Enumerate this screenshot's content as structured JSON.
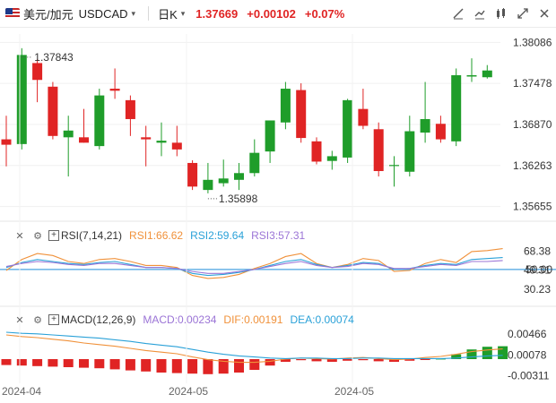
{
  "header": {
    "pair_label": "美元/加元",
    "symbol": "USDCAD",
    "caret": "▾",
    "timeframe": "日K",
    "timeframe_caret": "▾",
    "last_price": "1.37669",
    "change": "+0.00102",
    "change_pct": "+0.07%",
    "tools": [
      "draw-icon",
      "line-icon",
      "compare-icon",
      "expand-icon",
      "close-icon"
    ]
  },
  "colors": {
    "up": "#1f9d2a",
    "down": "#e02424",
    "rsi1": "#f0913a",
    "rsi2": "#2aa1d8",
    "rsi3": "#9b74d6"
  },
  "chart_data": [
    {
      "type": "candlestick",
      "title": "USDCAD 日K",
      "y_axis_ticks": [
        "1.38086",
        "1.37478",
        "1.36870",
        "1.36263",
        "1.35655"
      ],
      "y_axis_values": [
        1.38086,
        1.37478,
        1.3687,
        1.36263,
        1.35655
      ],
      "ylim": [
        1.3553,
        1.3821
      ],
      "annotations": {
        "high": "1.37843",
        "low": "1.35898"
      },
      "candles": [
        {
          "o": 1.3665,
          "h": 1.37,
          "l": 1.3625,
          "c": 1.3657
        },
        {
          "o": 1.3658,
          "h": 1.38,
          "l": 1.365,
          "c": 1.379
        },
        {
          "o": 1.3778,
          "h": 1.3784,
          "l": 1.372,
          "c": 1.3753
        },
        {
          "o": 1.3743,
          "h": 1.375,
          "l": 1.3665,
          "c": 1.367
        },
        {
          "o": 1.3668,
          "h": 1.37,
          "l": 1.361,
          "c": 1.3678
        },
        {
          "o": 1.3668,
          "h": 1.371,
          "l": 1.366,
          "c": 1.366
        },
        {
          "o": 1.3655,
          "h": 1.374,
          "l": 1.365,
          "c": 1.373
        },
        {
          "o": 1.374,
          "h": 1.377,
          "l": 1.3725,
          "c": 1.3737
        },
        {
          "o": 1.3723,
          "h": 1.373,
          "l": 1.367,
          "c": 1.3695
        },
        {
          "o": 1.3668,
          "h": 1.3685,
          "l": 1.3625,
          "c": 1.3665
        },
        {
          "o": 1.366,
          "h": 1.369,
          "l": 1.364,
          "c": 1.3663
        },
        {
          "o": 1.366,
          "h": 1.3685,
          "l": 1.364,
          "c": 1.365
        },
        {
          "o": 1.363,
          "h": 1.3634,
          "l": 1.359,
          "c": 1.3595
        },
        {
          "o": 1.359,
          "h": 1.363,
          "l": 1.3585,
          "c": 1.3605
        },
        {
          "o": 1.36,
          "h": 1.3635,
          "l": 1.3595,
          "c": 1.3607
        },
        {
          "o": 1.3605,
          "h": 1.363,
          "l": 1.359,
          "c": 1.3615
        },
        {
          "o": 1.3615,
          "h": 1.3665,
          "l": 1.361,
          "c": 1.3645
        },
        {
          "o": 1.3647,
          "h": 1.369,
          "l": 1.363,
          "c": 1.3693
        },
        {
          "o": 1.369,
          "h": 1.375,
          "l": 1.368,
          "c": 1.374
        },
        {
          "o": 1.3738,
          "h": 1.3748,
          "l": 1.366,
          "c": 1.3667
        },
        {
          "o": 1.3662,
          "h": 1.3668,
          "l": 1.3628,
          "c": 1.3632
        },
        {
          "o": 1.3633,
          "h": 1.3648,
          "l": 1.362,
          "c": 1.364
        },
        {
          "o": 1.3638,
          "h": 1.3725,
          "l": 1.363,
          "c": 1.3723
        },
        {
          "o": 1.371,
          "h": 1.374,
          "l": 1.368,
          "c": 1.3685
        },
        {
          "o": 1.368,
          "h": 1.369,
          "l": 1.361,
          "c": 1.3618
        },
        {
          "o": 1.3627,
          "h": 1.364,
          "l": 1.3595,
          "c": 1.3627
        },
        {
          "o": 1.3617,
          "h": 1.37,
          "l": 1.361,
          "c": 1.3677
        },
        {
          "o": 1.3675,
          "h": 1.375,
          "l": 1.366,
          "c": 1.3695
        },
        {
          "o": 1.3688,
          "h": 1.37,
          "l": 1.366,
          "c": 1.3665
        },
        {
          "o": 1.3662,
          "h": 1.377,
          "l": 1.3655,
          "c": 1.376
        },
        {
          "o": 1.3758,
          "h": 1.3785,
          "l": 1.375,
          "c": 1.376
        },
        {
          "o": 1.3757,
          "h": 1.3775,
          "l": 1.3755,
          "c": 1.3767
        }
      ],
      "x_axis_labels": [
        "2024-04",
        "2024-05",
        "2024-05"
      ]
    },
    {
      "type": "line",
      "title": "RSI(7,14,21)",
      "y_axis_ticks": [
        "68.38",
        "49.31",
        "30.23"
      ],
      "reference_line_label": "50.00",
      "series": [
        {
          "name": "RSI1",
          "current": "66.62",
          "color": "#f0913a",
          "values": [
            49,
            60,
            66,
            64,
            58,
            56,
            60,
            61,
            58,
            54,
            54,
            52,
            44,
            41,
            42,
            45,
            51,
            56,
            63,
            66,
            56,
            52,
            55,
            61,
            59,
            48,
            49,
            56,
            60,
            57,
            68,
            69,
            71
          ]
        },
        {
          "name": "RSI2",
          "current": "59.64",
          "color": "#2aa1d8",
          "values": [
            52,
            57,
            60,
            58,
            56,
            55,
            57,
            58,
            55,
            52,
            52,
            51,
            46,
            44,
            45,
            47,
            50,
            54,
            58,
            60,
            55,
            52,
            54,
            57,
            56,
            50,
            51,
            54,
            56,
            55,
            60,
            61,
            62
          ]
        },
        {
          "name": "RSI3",
          "current": "57.31",
          "color": "#9b74d6",
          "values": [
            53,
            56,
            58,
            57,
            55,
            54,
            56,
            56,
            54,
            52,
            52,
            51,
            48,
            46,
            46,
            48,
            50,
            53,
            56,
            58,
            54,
            52,
            53,
            56,
            55,
            51,
            51,
            53,
            55,
            54,
            58,
            58,
            59
          ]
        }
      ]
    },
    {
      "type": "bar",
      "title": "MACD(12,26,9)",
      "y_axis_ticks": [
        "0.00466",
        "0.00078",
        "-0.00311"
      ],
      "series": [
        {
          "name": "MACD",
          "current": "0.00234",
          "color": "#9b74d6",
          "values": [
            -0.0011,
            -0.0012,
            -0.0013,
            -0.0014,
            -0.0015,
            -0.0016,
            -0.0017,
            -0.0019,
            -0.0021,
            -0.0023,
            -0.0025,
            -0.0026,
            -0.0027,
            -0.0028,
            -0.0027,
            -0.0025,
            -0.002,
            -0.0012,
            -0.0005,
            -0.0002,
            -0.0004,
            -0.0005,
            -0.0003,
            -0.0002,
            -0.0004,
            -0.0005,
            -0.0003,
            -0.0001,
            0.0001,
            0.0009,
            0.0018,
            0.0023,
            0.0024
          ]
        },
        {
          "name": "DIF",
          "current": "0.00191",
          "color": "#f0913a",
          "values": [
            0.0045,
            0.0042,
            0.004,
            0.0037,
            0.0034,
            0.003,
            0.0027,
            0.0024,
            0.002,
            0.0016,
            0.0013,
            0.001,
            0.0004,
            -0.0001,
            -0.0004,
            -0.0006,
            -0.0006,
            -0.0004,
            0.0,
            0.0002,
            0.0001,
            0.0,
            0.0002,
            0.0003,
            0.0001,
            -0.0001,
            0.0,
            0.0003,
            0.0005,
            0.0009,
            0.0014,
            0.0017,
            0.0019
          ]
        },
        {
          "name": "DEA",
          "current": "0.00074",
          "color": "#2aa1d8",
          "values": [
            0.005,
            0.0048,
            0.0047,
            0.0045,
            0.0043,
            0.0041,
            0.0039,
            0.0036,
            0.0033,
            0.0029,
            0.0026,
            0.0023,
            0.0018,
            0.0013,
            0.0009,
            0.0006,
            0.0004,
            0.0002,
            0.0001,
            0.0002,
            0.0002,
            0.0001,
            0.0001,
            0.0002,
            0.0002,
            0.0001,
            0.0001,
            0.0001,
            0.0001,
            0.0002,
            0.0004,
            0.0006,
            0.0007
          ]
        }
      ]
    }
  ],
  "rsi_panel": {
    "name": "RSI(7,14,21)",
    "rsi1": "RSI1:66.62",
    "rsi2": "RSI2:59.64",
    "rsi3": "RSI3:57.31"
  },
  "macd_panel": {
    "name": "MACD(12,26,9)",
    "macd": "MACD:0.00234",
    "dif": "DIF:0.00191",
    "dea": "DEA:0.00074"
  }
}
